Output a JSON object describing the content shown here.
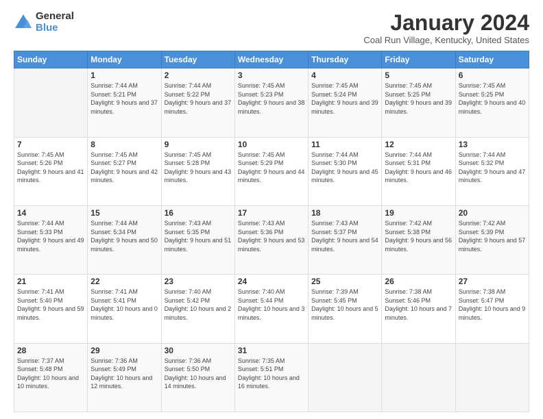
{
  "logo": {
    "general": "General",
    "blue": "Blue"
  },
  "title": "January 2024",
  "location": "Coal Run Village, Kentucky, United States",
  "weekdays": [
    "Sunday",
    "Monday",
    "Tuesday",
    "Wednesday",
    "Thursday",
    "Friday",
    "Saturday"
  ],
  "weeks": [
    [
      {
        "day": "",
        "sunrise": "",
        "sunset": "",
        "daylight": ""
      },
      {
        "day": "1",
        "sunrise": "Sunrise: 7:44 AM",
        "sunset": "Sunset: 5:21 PM",
        "daylight": "Daylight: 9 hours and 37 minutes."
      },
      {
        "day": "2",
        "sunrise": "Sunrise: 7:44 AM",
        "sunset": "Sunset: 5:22 PM",
        "daylight": "Daylight: 9 hours and 37 minutes."
      },
      {
        "day": "3",
        "sunrise": "Sunrise: 7:45 AM",
        "sunset": "Sunset: 5:23 PM",
        "daylight": "Daylight: 9 hours and 38 minutes."
      },
      {
        "day": "4",
        "sunrise": "Sunrise: 7:45 AM",
        "sunset": "Sunset: 5:24 PM",
        "daylight": "Daylight: 9 hours and 39 minutes."
      },
      {
        "day": "5",
        "sunrise": "Sunrise: 7:45 AM",
        "sunset": "Sunset: 5:25 PM",
        "daylight": "Daylight: 9 hours and 39 minutes."
      },
      {
        "day": "6",
        "sunrise": "Sunrise: 7:45 AM",
        "sunset": "Sunset: 5:25 PM",
        "daylight": "Daylight: 9 hours and 40 minutes."
      }
    ],
    [
      {
        "day": "7",
        "sunrise": "Sunrise: 7:45 AM",
        "sunset": "Sunset: 5:26 PM",
        "daylight": "Daylight: 9 hours and 41 minutes."
      },
      {
        "day": "8",
        "sunrise": "Sunrise: 7:45 AM",
        "sunset": "Sunset: 5:27 PM",
        "daylight": "Daylight: 9 hours and 42 minutes."
      },
      {
        "day": "9",
        "sunrise": "Sunrise: 7:45 AM",
        "sunset": "Sunset: 5:28 PM",
        "daylight": "Daylight: 9 hours and 43 minutes."
      },
      {
        "day": "10",
        "sunrise": "Sunrise: 7:45 AM",
        "sunset": "Sunset: 5:29 PM",
        "daylight": "Daylight: 9 hours and 44 minutes."
      },
      {
        "day": "11",
        "sunrise": "Sunrise: 7:44 AM",
        "sunset": "Sunset: 5:30 PM",
        "daylight": "Daylight: 9 hours and 45 minutes."
      },
      {
        "day": "12",
        "sunrise": "Sunrise: 7:44 AM",
        "sunset": "Sunset: 5:31 PM",
        "daylight": "Daylight: 9 hours and 46 minutes."
      },
      {
        "day": "13",
        "sunrise": "Sunrise: 7:44 AM",
        "sunset": "Sunset: 5:32 PM",
        "daylight": "Daylight: 9 hours and 47 minutes."
      }
    ],
    [
      {
        "day": "14",
        "sunrise": "Sunrise: 7:44 AM",
        "sunset": "Sunset: 5:33 PM",
        "daylight": "Daylight: 9 hours and 49 minutes."
      },
      {
        "day": "15",
        "sunrise": "Sunrise: 7:44 AM",
        "sunset": "Sunset: 5:34 PM",
        "daylight": "Daylight: 9 hours and 50 minutes."
      },
      {
        "day": "16",
        "sunrise": "Sunrise: 7:43 AM",
        "sunset": "Sunset: 5:35 PM",
        "daylight": "Daylight: 9 hours and 51 minutes."
      },
      {
        "day": "17",
        "sunrise": "Sunrise: 7:43 AM",
        "sunset": "Sunset: 5:36 PM",
        "daylight": "Daylight: 9 hours and 53 minutes."
      },
      {
        "day": "18",
        "sunrise": "Sunrise: 7:43 AM",
        "sunset": "Sunset: 5:37 PM",
        "daylight": "Daylight: 9 hours and 54 minutes."
      },
      {
        "day": "19",
        "sunrise": "Sunrise: 7:42 AM",
        "sunset": "Sunset: 5:38 PM",
        "daylight": "Daylight: 9 hours and 56 minutes."
      },
      {
        "day": "20",
        "sunrise": "Sunrise: 7:42 AM",
        "sunset": "Sunset: 5:39 PM",
        "daylight": "Daylight: 9 hours and 57 minutes."
      }
    ],
    [
      {
        "day": "21",
        "sunrise": "Sunrise: 7:41 AM",
        "sunset": "Sunset: 5:40 PM",
        "daylight": "Daylight: 9 hours and 59 minutes."
      },
      {
        "day": "22",
        "sunrise": "Sunrise: 7:41 AM",
        "sunset": "Sunset: 5:41 PM",
        "daylight": "Daylight: 10 hours and 0 minutes."
      },
      {
        "day": "23",
        "sunrise": "Sunrise: 7:40 AM",
        "sunset": "Sunset: 5:42 PM",
        "daylight": "Daylight: 10 hours and 2 minutes."
      },
      {
        "day": "24",
        "sunrise": "Sunrise: 7:40 AM",
        "sunset": "Sunset: 5:44 PM",
        "daylight": "Daylight: 10 hours and 3 minutes."
      },
      {
        "day": "25",
        "sunrise": "Sunrise: 7:39 AM",
        "sunset": "Sunset: 5:45 PM",
        "daylight": "Daylight: 10 hours and 5 minutes."
      },
      {
        "day": "26",
        "sunrise": "Sunrise: 7:38 AM",
        "sunset": "Sunset: 5:46 PM",
        "daylight": "Daylight: 10 hours and 7 minutes."
      },
      {
        "day": "27",
        "sunrise": "Sunrise: 7:38 AM",
        "sunset": "Sunset: 5:47 PM",
        "daylight": "Daylight: 10 hours and 9 minutes."
      }
    ],
    [
      {
        "day": "28",
        "sunrise": "Sunrise: 7:37 AM",
        "sunset": "Sunset: 5:48 PM",
        "daylight": "Daylight: 10 hours and 10 minutes."
      },
      {
        "day": "29",
        "sunrise": "Sunrise: 7:36 AM",
        "sunset": "Sunset: 5:49 PM",
        "daylight": "Daylight: 10 hours and 12 minutes."
      },
      {
        "day": "30",
        "sunrise": "Sunrise: 7:36 AM",
        "sunset": "Sunset: 5:50 PM",
        "daylight": "Daylight: 10 hours and 14 minutes."
      },
      {
        "day": "31",
        "sunrise": "Sunrise: 7:35 AM",
        "sunset": "Sunset: 5:51 PM",
        "daylight": "Daylight: 10 hours and 16 minutes."
      },
      {
        "day": "",
        "sunrise": "",
        "sunset": "",
        "daylight": ""
      },
      {
        "day": "",
        "sunrise": "",
        "sunset": "",
        "daylight": ""
      },
      {
        "day": "",
        "sunrise": "",
        "sunset": "",
        "daylight": ""
      }
    ]
  ]
}
